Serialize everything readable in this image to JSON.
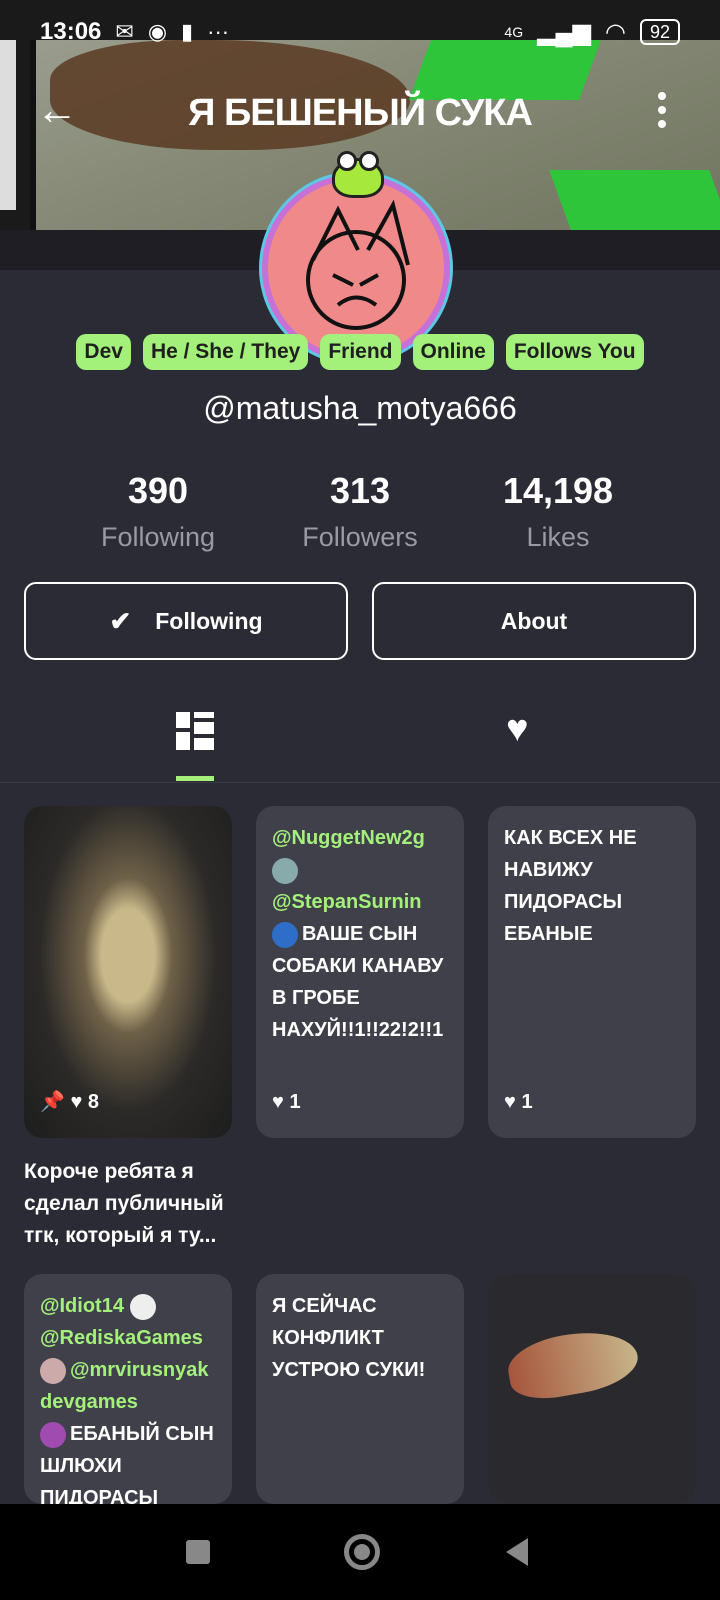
{
  "status_bar": {
    "time": "13:06",
    "network": "4G",
    "battery": "92"
  },
  "header": {
    "title": "Я БЕШЕНЫЙ СУКА"
  },
  "tags": [
    "Dev",
    "He / She / They",
    "Friend",
    "Online",
    "Follows You"
  ],
  "username": "@matusha_motya666",
  "stats": [
    {
      "value": "390",
      "label": "Following"
    },
    {
      "value": "313",
      "label": "Followers"
    },
    {
      "value": "14,198",
      "label": "Likes"
    }
  ],
  "buttons": {
    "following": "Following",
    "about": "About"
  },
  "posts": [
    {
      "likes": "8",
      "caption": "Короче ребята я сделал публичный тгк, который я ту..."
    },
    {
      "mention1": "@NuggetNew2g",
      "mention2": "@StepanSurnin",
      "text": "ВАШЕ СЫН СОБАКИ КАНАВУ В ГРОБЕ НАХУЙ!!1!!22!2!!1",
      "likes": "1"
    },
    {
      "text": "КАК ВСЕХ НЕ НАВИЖУ ПИДОРАСЫ ЕБАНЫЕ",
      "likes": "1"
    },
    {
      "mention1": "@Idiot14",
      "mention2": "@RediskaGames",
      "mention3": "@mrvirusnyakdevgames",
      "text": "ЕБАНЫЙ СЫН ШЛЮХИ ПИДОРАСЫ"
    },
    {
      "text": "Я СЕЙЧАС КОНФЛИКТ УСТРОЮ СУКИ!"
    }
  ],
  "colors": {
    "background": "#2b2b35",
    "accent": "#a3f07a",
    "card": "#40404a"
  }
}
